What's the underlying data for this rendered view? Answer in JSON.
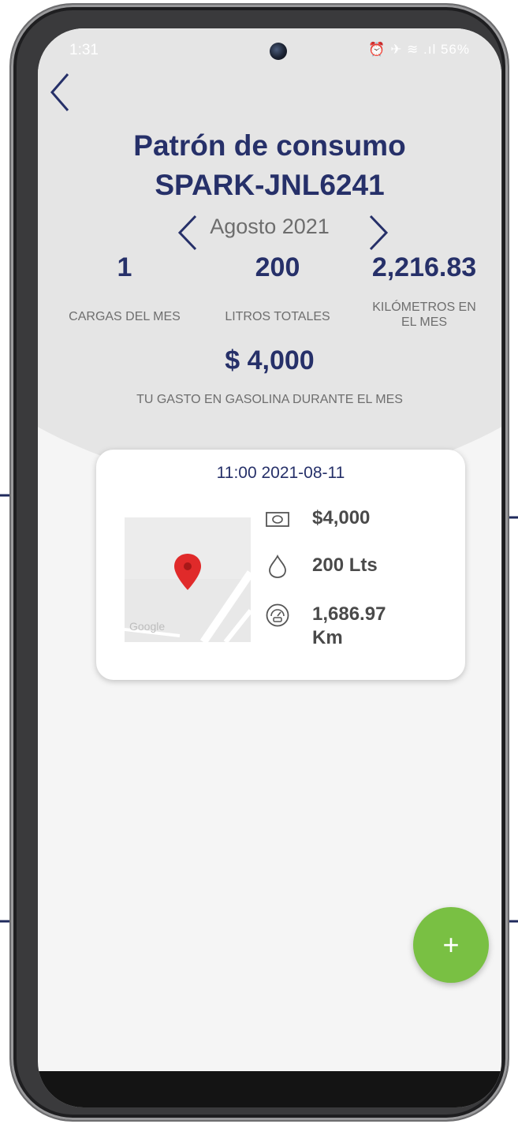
{
  "status_bar": {
    "time": "1:31",
    "icons_text": "⏰ ✈ ≋ .ıl 56%"
  },
  "header": {
    "title": "Patrón de consumo",
    "subtitle": "SPARK-JNL6241",
    "month": "Agosto 2021"
  },
  "stats": {
    "cargas_value": "1",
    "cargas_label": "CARGAS DEL MES",
    "litros_value": "200",
    "litros_label": "LITROS TOTALES",
    "km_value": "2,216.83",
    "km_label_line1": "KILÓMETROS EN",
    "km_label_line2": "EL MES",
    "gasto_value": "$ 4,000",
    "gasto_label": "TU GASTO EN GASOLINA DURANTE EL MES"
  },
  "card": {
    "datetime": "11:00 2021-08-11",
    "amount": "$4,000",
    "liters": "200 Lts",
    "km_line1": "1,686.97",
    "km_line2": "Km",
    "map_watermark": "Google",
    "icons": [
      "money-icon",
      "drop-icon",
      "gauge-icon"
    ]
  },
  "fab": {
    "label": "+"
  },
  "colors": {
    "primary": "#263069",
    "fab": "#79c043",
    "marker": "#e02a2a",
    "header_bg": "#e5e5e5"
  }
}
